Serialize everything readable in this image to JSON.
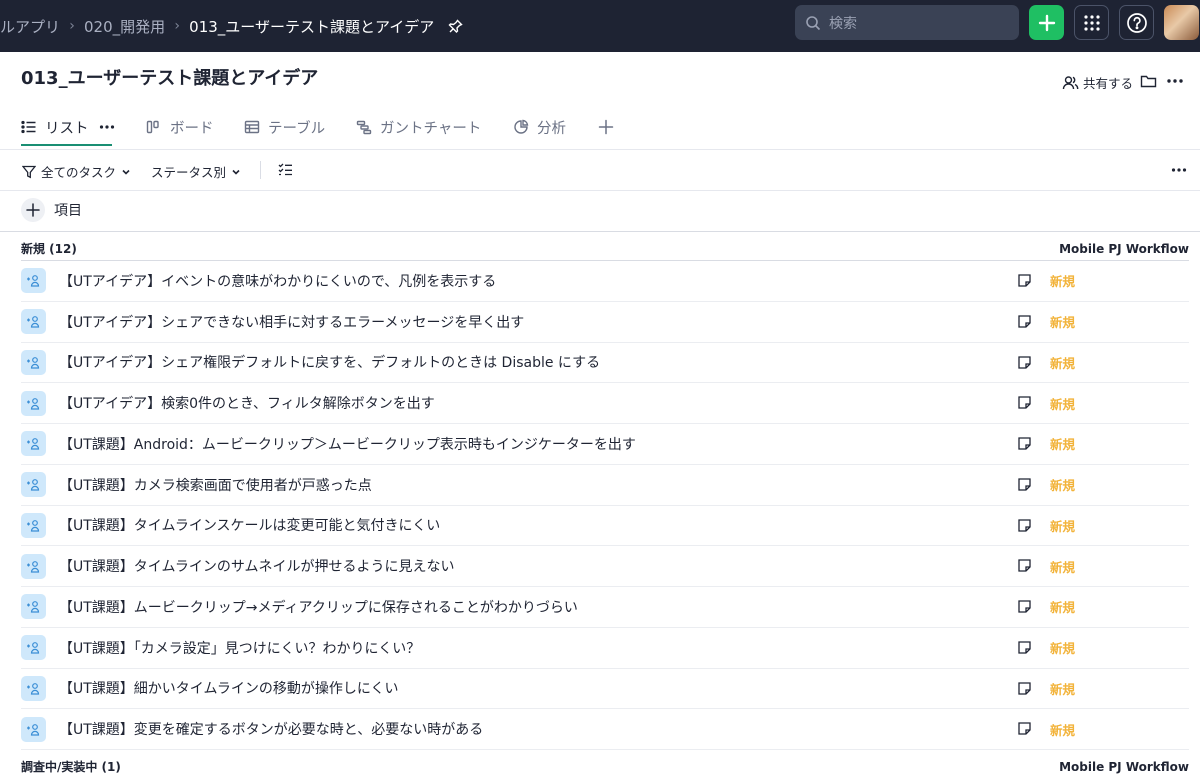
{
  "breadcrumbs": [
    {
      "label": "ルアプリ"
    },
    {
      "label": "020_開発用"
    },
    {
      "label": "013_ユーザーテスト課題とアイデア"
    }
  ],
  "search": {
    "placeholder": "検索"
  },
  "header": {
    "title": "013_ユーザーテスト課題とアイデア",
    "share_label": "共有する"
  },
  "tabs": [
    {
      "label": "リスト",
      "icon": "list-icon",
      "active": true
    },
    {
      "label": "ボード",
      "icon": "board-icon",
      "active": false
    },
    {
      "label": "テーブル",
      "icon": "table-icon",
      "active": false
    },
    {
      "label": "ガントチャート",
      "icon": "gantt-icon",
      "active": false
    },
    {
      "label": "分析",
      "icon": "chart-icon",
      "active": false
    }
  ],
  "filters": {
    "all_tasks": "全てのタスク",
    "group_by": "ステータス別"
  },
  "add_item_label": "項目",
  "groups": [
    {
      "name": "新規 (12)",
      "workflow": "Mobile PJ Workflow",
      "tasks": [
        {
          "title": "【UTアイデア】イベントの意味がわかりにくいので、凡例を表示する",
          "status": "新規"
        },
        {
          "title": "【UTアイデア】シェアできない相手に対するエラーメッセージを早く出す",
          "status": "新規"
        },
        {
          "title": "【UTアイデア】シェア権限デフォルトに戻すを、デフォルトのときは Disable にする",
          "status": "新規"
        },
        {
          "title": "【UTアイデア】検索0件のとき、フィルタ解除ボタンを出す",
          "status": "新規"
        },
        {
          "title": "【UT課題】Android：ムービークリップ＞ムービークリップ表示時もインジケーターを出す",
          "status": "新規"
        },
        {
          "title": "【UT課題】カメラ検索画面で使用者が戸惑った点",
          "status": "新規"
        },
        {
          "title": "【UT課題】タイムラインスケールは変更可能と気付きにくい",
          "status": "新規"
        },
        {
          "title": "【UT課題】タイムラインのサムネイルが押せるように見えない",
          "status": "新規"
        },
        {
          "title": "【UT課題】ムービークリップ→メディアクリップに保存されることがわかりづらい",
          "status": "新規"
        },
        {
          "title": "【UT課題】「カメラ設定」見つけにくい？わかりにくい？",
          "status": "新規"
        },
        {
          "title": "【UT課題】細かいタイムラインの移動が操作しにくい",
          "status": "新規"
        },
        {
          "title": "【UT課題】変更を確定するボタンが必要な時と、必要ない時がある",
          "status": "新規"
        }
      ]
    },
    {
      "name": "調査中/実装中 (1)",
      "workflow": "Mobile PJ Workflow",
      "tasks": []
    }
  ],
  "colors": {
    "topbar": "#1e2333",
    "accent_green": "#1fbf63",
    "status_new": "#f2b33a",
    "tab_underline": "#1a8f73"
  }
}
